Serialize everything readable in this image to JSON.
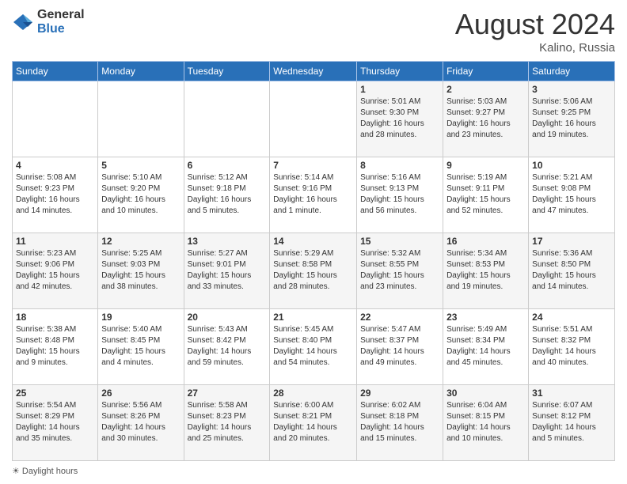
{
  "logo": {
    "general": "General",
    "blue": "Blue"
  },
  "title": {
    "month_year": "August 2024",
    "location": "Kalino, Russia"
  },
  "weekdays": [
    "Sunday",
    "Monday",
    "Tuesday",
    "Wednesday",
    "Thursday",
    "Friday",
    "Saturday"
  ],
  "weeks": [
    [
      {
        "day": "",
        "detail": ""
      },
      {
        "day": "",
        "detail": ""
      },
      {
        "day": "",
        "detail": ""
      },
      {
        "day": "",
        "detail": ""
      },
      {
        "day": "1",
        "detail": "Sunrise: 5:01 AM\nSunset: 9:30 PM\nDaylight: 16 hours\nand 28 minutes."
      },
      {
        "day": "2",
        "detail": "Sunrise: 5:03 AM\nSunset: 9:27 PM\nDaylight: 16 hours\nand 23 minutes."
      },
      {
        "day": "3",
        "detail": "Sunrise: 5:06 AM\nSunset: 9:25 PM\nDaylight: 16 hours\nand 19 minutes."
      }
    ],
    [
      {
        "day": "4",
        "detail": "Sunrise: 5:08 AM\nSunset: 9:23 PM\nDaylight: 16 hours\nand 14 minutes."
      },
      {
        "day": "5",
        "detail": "Sunrise: 5:10 AM\nSunset: 9:20 PM\nDaylight: 16 hours\nand 10 minutes."
      },
      {
        "day": "6",
        "detail": "Sunrise: 5:12 AM\nSunset: 9:18 PM\nDaylight: 16 hours\nand 5 minutes."
      },
      {
        "day": "7",
        "detail": "Sunrise: 5:14 AM\nSunset: 9:16 PM\nDaylight: 16 hours\nand 1 minute."
      },
      {
        "day": "8",
        "detail": "Sunrise: 5:16 AM\nSunset: 9:13 PM\nDaylight: 15 hours\nand 56 minutes."
      },
      {
        "day": "9",
        "detail": "Sunrise: 5:19 AM\nSunset: 9:11 PM\nDaylight: 15 hours\nand 52 minutes."
      },
      {
        "day": "10",
        "detail": "Sunrise: 5:21 AM\nSunset: 9:08 PM\nDaylight: 15 hours\nand 47 minutes."
      }
    ],
    [
      {
        "day": "11",
        "detail": "Sunrise: 5:23 AM\nSunset: 9:06 PM\nDaylight: 15 hours\nand 42 minutes."
      },
      {
        "day": "12",
        "detail": "Sunrise: 5:25 AM\nSunset: 9:03 PM\nDaylight: 15 hours\nand 38 minutes."
      },
      {
        "day": "13",
        "detail": "Sunrise: 5:27 AM\nSunset: 9:01 PM\nDaylight: 15 hours\nand 33 minutes."
      },
      {
        "day": "14",
        "detail": "Sunrise: 5:29 AM\nSunset: 8:58 PM\nDaylight: 15 hours\nand 28 minutes."
      },
      {
        "day": "15",
        "detail": "Sunrise: 5:32 AM\nSunset: 8:55 PM\nDaylight: 15 hours\nand 23 minutes."
      },
      {
        "day": "16",
        "detail": "Sunrise: 5:34 AM\nSunset: 8:53 PM\nDaylight: 15 hours\nand 19 minutes."
      },
      {
        "day": "17",
        "detail": "Sunrise: 5:36 AM\nSunset: 8:50 PM\nDaylight: 15 hours\nand 14 minutes."
      }
    ],
    [
      {
        "day": "18",
        "detail": "Sunrise: 5:38 AM\nSunset: 8:48 PM\nDaylight: 15 hours\nand 9 minutes."
      },
      {
        "day": "19",
        "detail": "Sunrise: 5:40 AM\nSunset: 8:45 PM\nDaylight: 15 hours\nand 4 minutes."
      },
      {
        "day": "20",
        "detail": "Sunrise: 5:43 AM\nSunset: 8:42 PM\nDaylight: 14 hours\nand 59 minutes."
      },
      {
        "day": "21",
        "detail": "Sunrise: 5:45 AM\nSunset: 8:40 PM\nDaylight: 14 hours\nand 54 minutes."
      },
      {
        "day": "22",
        "detail": "Sunrise: 5:47 AM\nSunset: 8:37 PM\nDaylight: 14 hours\nand 49 minutes."
      },
      {
        "day": "23",
        "detail": "Sunrise: 5:49 AM\nSunset: 8:34 PM\nDaylight: 14 hours\nand 45 minutes."
      },
      {
        "day": "24",
        "detail": "Sunrise: 5:51 AM\nSunset: 8:32 PM\nDaylight: 14 hours\nand 40 minutes."
      }
    ],
    [
      {
        "day": "25",
        "detail": "Sunrise: 5:54 AM\nSunset: 8:29 PM\nDaylight: 14 hours\nand 35 minutes."
      },
      {
        "day": "26",
        "detail": "Sunrise: 5:56 AM\nSunset: 8:26 PM\nDaylight: 14 hours\nand 30 minutes."
      },
      {
        "day": "27",
        "detail": "Sunrise: 5:58 AM\nSunset: 8:23 PM\nDaylight: 14 hours\nand 25 minutes."
      },
      {
        "day": "28",
        "detail": "Sunrise: 6:00 AM\nSunset: 8:21 PM\nDaylight: 14 hours\nand 20 minutes."
      },
      {
        "day": "29",
        "detail": "Sunrise: 6:02 AM\nSunset: 8:18 PM\nDaylight: 14 hours\nand 15 minutes."
      },
      {
        "day": "30",
        "detail": "Sunrise: 6:04 AM\nSunset: 8:15 PM\nDaylight: 14 hours\nand 10 minutes."
      },
      {
        "day": "31",
        "detail": "Sunrise: 6:07 AM\nSunset: 8:12 PM\nDaylight: 14 hours\nand 5 minutes."
      }
    ]
  ],
  "legend": "Daylight hours"
}
